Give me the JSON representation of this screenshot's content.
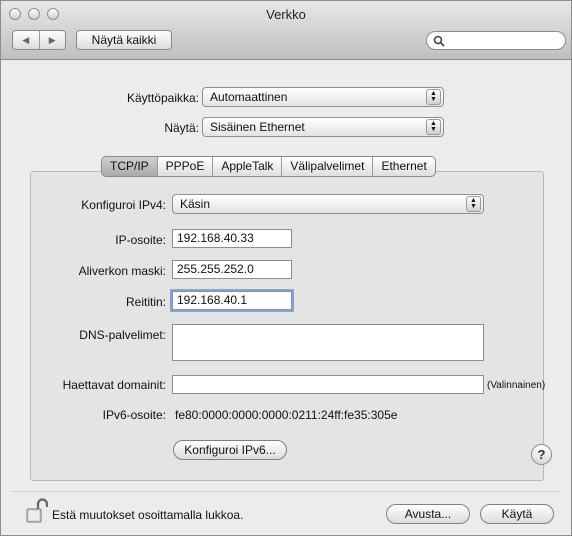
{
  "window": {
    "title": "Verkko"
  },
  "toolbar": {
    "back_icon": "◀",
    "forward_icon": "▶",
    "show_all_label": "Näytä kaikki",
    "search_placeholder": ""
  },
  "location": {
    "label": "Käyttöpaikka:",
    "value": "Automaattinen"
  },
  "show": {
    "label": "Näytä:",
    "value": "Sisäinen Ethernet"
  },
  "tabs": [
    {
      "label": "TCP/IP",
      "active": true
    },
    {
      "label": "PPPoE",
      "active": false
    },
    {
      "label": "AppleTalk",
      "active": false
    },
    {
      "label": "Välipalvelimet",
      "active": false
    },
    {
      "label": "Ethernet",
      "active": false
    }
  ],
  "tcpip": {
    "configure_ipv4_label": "Konfiguroi IPv4:",
    "configure_ipv4_value": "Käsin",
    "ip_label": "IP-osoite:",
    "ip_value": "192.168.40.33",
    "subnet_label": "Aliverkon maski:",
    "subnet_value": "255.255.252.0",
    "router_label": "Reititin:",
    "router_value": "192.168.40.1",
    "dns_label": "DNS-palvelimet:",
    "dns_value": "",
    "search_domains_label": "Haettavat domainit:",
    "search_domains_value": "",
    "optional_note": "(Valinnainen)",
    "ipv6_label": "IPv6-osoite:",
    "ipv6_value": "fe80:0000:0000:0000:0211:24ff:fe35:305e",
    "configure_ipv6_button": "Konfiguroi IPv6...",
    "help_label": "?"
  },
  "footer": {
    "lock_text": "Estä muutokset osoittamalla lukkoa.",
    "assist_button": "Avusta...",
    "apply_button": "Käytä"
  }
}
